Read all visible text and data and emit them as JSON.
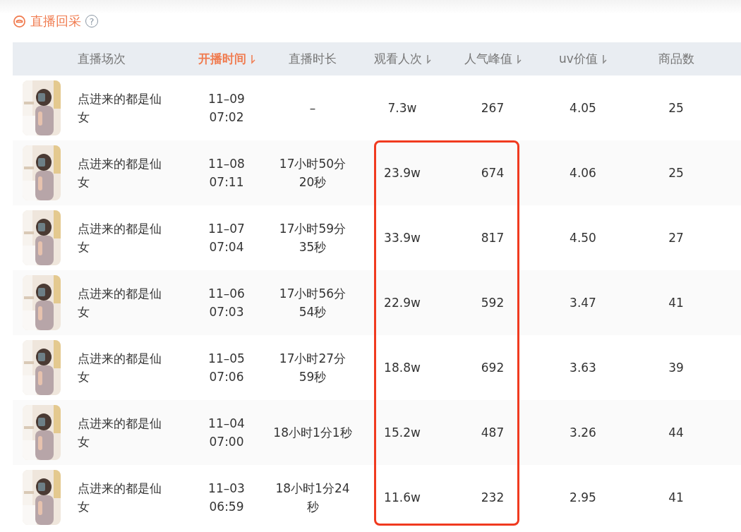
{
  "section": {
    "title": "直播回采",
    "help": "?"
  },
  "table": {
    "columns": [
      {
        "label": "直播场次",
        "sortable": false,
        "selected": false
      },
      {
        "label": "开播时间",
        "sortable": true,
        "selected": true
      },
      {
        "label": "直播时长",
        "sortable": false,
        "selected": false
      },
      {
        "label": "观看人次",
        "sortable": true,
        "selected": false
      },
      {
        "label": "人气峰值",
        "sortable": true,
        "selected": false
      },
      {
        "label": "uv价值",
        "sortable": true,
        "selected": false
      },
      {
        "label": "商品数",
        "sortable": false,
        "selected": false
      }
    ],
    "rows": [
      {
        "name": "点进来的都是仙女",
        "date": "11–09",
        "time": "07:02",
        "duration": "–",
        "viewers": "7.3w",
        "peak": "267",
        "uv": "4.05",
        "goods": "25",
        "highlighted": false
      },
      {
        "name": "点进来的都是仙女",
        "date": "11–08",
        "time": "07:11",
        "duration": "17小时50分20秒",
        "viewers": "23.9w",
        "peak": "674",
        "uv": "4.06",
        "goods": "25",
        "highlighted": true
      },
      {
        "name": "点进来的都是仙女",
        "date": "11–07",
        "time": "07:04",
        "duration": "17小时59分35秒",
        "viewers": "33.9w",
        "peak": "817",
        "uv": "4.50",
        "goods": "27",
        "highlighted": true
      },
      {
        "name": "点进来的都是仙女",
        "date": "11–06",
        "time": "07:03",
        "duration": "17小时56分54秒",
        "viewers": "22.9w",
        "peak": "592",
        "uv": "3.47",
        "goods": "41",
        "highlighted": true
      },
      {
        "name": "点进来的都是仙女",
        "date": "11–05",
        "time": "07:06",
        "duration": "17小时27分59秒",
        "viewers": "18.8w",
        "peak": "692",
        "uv": "3.63",
        "goods": "39",
        "highlighted": true
      },
      {
        "name": "点进来的都是仙女",
        "date": "11–04",
        "time": "07:00",
        "duration": "18小时1分1秒",
        "viewers": "15.2w",
        "peak": "487",
        "uv": "3.26",
        "goods": "44",
        "highlighted": true
      },
      {
        "name": "点进来的都是仙女",
        "date": "11–03",
        "time": "06:59",
        "duration": "18小时1分24秒",
        "viewers": "11.6w",
        "peak": "232",
        "uv": "2.95",
        "goods": "41",
        "highlighted": true
      }
    ]
  }
}
